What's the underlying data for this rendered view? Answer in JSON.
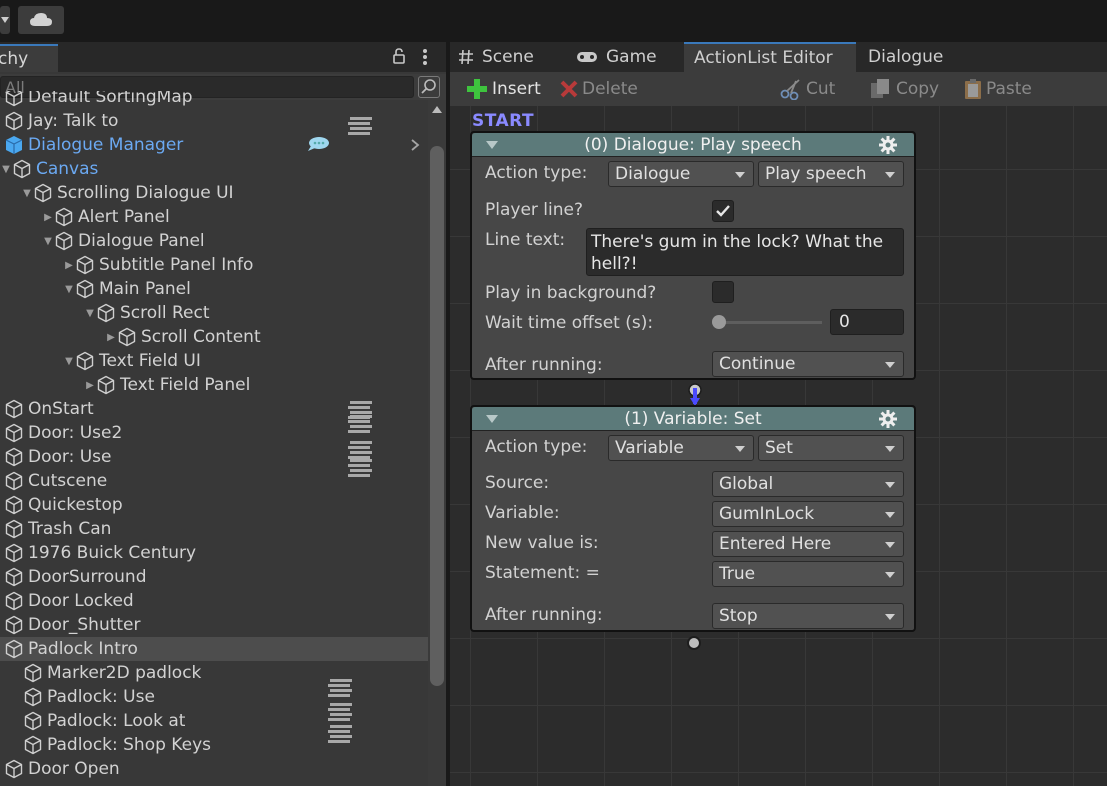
{
  "toolbar": {},
  "hierarchy": {
    "tab_label": "chy",
    "search_placeholder": "All",
    "items": [
      {
        "label": "Default SortingMap"
      },
      {
        "label": "Jay: Talk to"
      },
      {
        "label": "Dialogue Manager"
      },
      {
        "label": "Canvas"
      },
      {
        "label": "Scrolling Dialogue UI"
      },
      {
        "label": "Alert Panel"
      },
      {
        "label": "Dialogue Panel"
      },
      {
        "label": "Subtitle Panel Info"
      },
      {
        "label": "Main Panel"
      },
      {
        "label": "Scroll Rect"
      },
      {
        "label": "Scroll Content"
      },
      {
        "label": "Text Field UI"
      },
      {
        "label": "Text Field Panel"
      },
      {
        "label": "OnStart"
      },
      {
        "label": "Door: Use2"
      },
      {
        "label": "Door: Use"
      },
      {
        "label": "Cutscene"
      },
      {
        "label": "Quickestop"
      },
      {
        "label": "Trash Can"
      },
      {
        "label": "1976 Buick Century"
      },
      {
        "label": "DoorSurround"
      },
      {
        "label": "Door Locked"
      },
      {
        "label": "Door_Shutter"
      },
      {
        "label": "Padlock Intro"
      },
      {
        "label": "Marker2D padlock"
      },
      {
        "label": "Padlock: Use"
      },
      {
        "label": "Padlock: Look at"
      },
      {
        "label": "Padlock: Shop Keys"
      },
      {
        "label": "Door Open"
      }
    ]
  },
  "editor": {
    "tabs": [
      {
        "label": "Scene"
      },
      {
        "label": "Game"
      },
      {
        "label": "ActionList Editor"
      },
      {
        "label": "Dialogue"
      }
    ],
    "tools": {
      "insert": "Insert",
      "delete": "Delete",
      "cut": "Cut",
      "copy": "Copy",
      "paste": "Paste"
    },
    "start_label": "START",
    "node0": {
      "title": "(0) Dialogue: Play speech",
      "action_type_label": "Action type:",
      "action_type_category": "Dialogue",
      "action_type_action": "Play speech",
      "player_line_label": "Player line?",
      "player_line_checked": true,
      "line_text_label": "Line text:",
      "line_text": "There's gum in the lock? What the hell?!",
      "play_bg_label": "Play in background?",
      "play_bg_checked": false,
      "wait_offset_label": "Wait time offset (s):",
      "wait_offset_value": "0",
      "after_running_label": "After running:",
      "after_running": "Continue"
    },
    "node1": {
      "title": "(1) Variable: Set",
      "action_type_label": "Action type:",
      "action_type_category": "Variable",
      "action_type_action": "Set",
      "source_label": "Source:",
      "source": "Global",
      "variable_label": "Variable:",
      "variable": "GumInLock",
      "new_value_label": "New value is:",
      "new_value": "Entered Here",
      "statement_label": "Statement: =",
      "statement": "True",
      "after_running_label": "After running:",
      "after_running": "Stop"
    }
  },
  "colors": {
    "accent_blue": "#3a79bb",
    "selected_text_blue": "#6ba9f2",
    "node_header": "#5c7a7a",
    "start_label": "#8a8aff",
    "insert_green": "#3ec43e",
    "delete_red": "#b83a3a"
  }
}
